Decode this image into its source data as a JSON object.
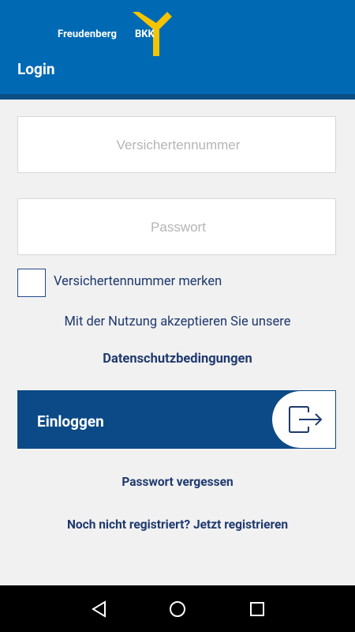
{
  "header": {
    "brand_name": "Freudenberg",
    "brand_suffix": "BKK",
    "title": "Login",
    "colors": {
      "primary": "#0069b4",
      "shadow": "#0a4f86"
    }
  },
  "form": {
    "insurance_number": {
      "placeholder": "Versichertennummer",
      "value": ""
    },
    "password": {
      "placeholder": "Passwort",
      "value": ""
    },
    "remember": {
      "label": "Versichertennummer merken",
      "checked": false
    },
    "terms_text": "Mit der Nutzung akzeptieren Sie unsere",
    "privacy_link": "Datenschutzbedingungen",
    "login_button": {
      "label": "Einloggen",
      "icon": "login-arrow-icon",
      "color": "#0b4a86"
    },
    "forgot_password": "Passwort vergessen",
    "register": "Noch nicht registriert? Jetzt registrieren"
  },
  "navigation_bar": {
    "buttons": [
      "back-icon",
      "home-icon",
      "recents-icon"
    ]
  }
}
